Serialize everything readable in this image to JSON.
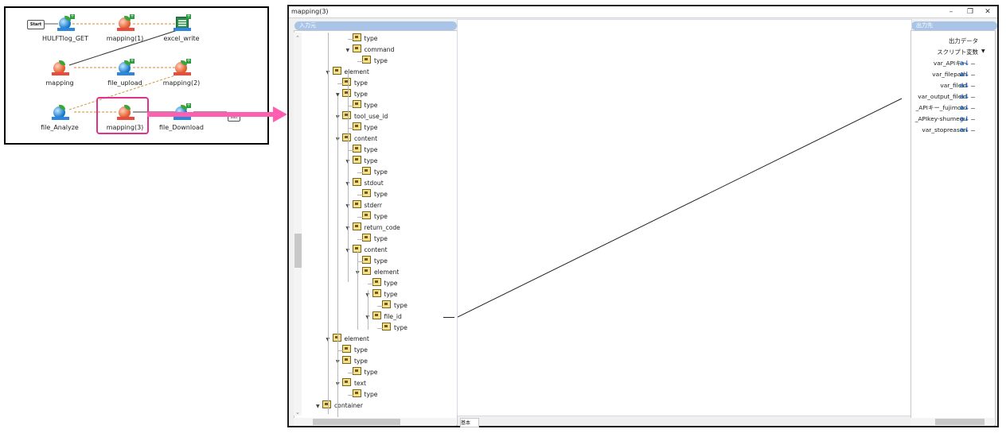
{
  "flow": {
    "start_label": "Start",
    "end_label": "End",
    "nodes": {
      "hulftlog_get": "HULFTlog_GET",
      "mapping1": "mapping(1)",
      "excel_write": "excel_write",
      "mapping": "mapping",
      "file_upload": "file_upload",
      "mapping2": "mapping(2)",
      "file_analyze": "file_Analyze",
      "mapping3": "mapping(3)",
      "file_download": "file_Download"
    }
  },
  "window": {
    "title": "mapping(3)",
    "minimize": "–",
    "restore": "❐",
    "close": "✕",
    "input_header": "入力元",
    "output_header": "出力先",
    "bottom_tab": "基本"
  },
  "input_tree": [
    {
      "label": "type",
      "level": 3,
      "expand": false
    },
    {
      "label": "command",
      "level": 3,
      "expand": true
    },
    {
      "label": "type",
      "level": 4,
      "expand": false
    },
    {
      "label": "element",
      "level": 1,
      "expand": true
    },
    {
      "label": "type",
      "level": 2,
      "expand": false
    },
    {
      "label": "type",
      "level": 2,
      "expand": true
    },
    {
      "label": "type",
      "level": 3,
      "expand": false
    },
    {
      "label": "tool_use_id",
      "level": 2,
      "expand": true
    },
    {
      "label": "type",
      "level": 3,
      "expand": false
    },
    {
      "label": "content",
      "level": 2,
      "expand": true
    },
    {
      "label": "type",
      "level": 3,
      "expand": false
    },
    {
      "label": "type",
      "level": 3,
      "expand": true
    },
    {
      "label": "type",
      "level": 4,
      "expand": false
    },
    {
      "label": "stdout",
      "level": 3,
      "expand": true
    },
    {
      "label": "type",
      "level": 4,
      "expand": false
    },
    {
      "label": "stderr",
      "level": 3,
      "expand": true
    },
    {
      "label": "type",
      "level": 4,
      "expand": false
    },
    {
      "label": "return_code",
      "level": 3,
      "expand": true
    },
    {
      "label": "type",
      "level": 4,
      "expand": false
    },
    {
      "label": "content",
      "level": 3,
      "expand": true
    },
    {
      "label": "type",
      "level": 4,
      "expand": false
    },
    {
      "label": "element",
      "level": 4,
      "expand": true
    },
    {
      "label": "type",
      "level": 5,
      "expand": false
    },
    {
      "label": "type",
      "level": 5,
      "expand": true
    },
    {
      "label": "type",
      "level": 6,
      "expand": false
    },
    {
      "label": "file_id",
      "level": 5,
      "expand": true
    },
    {
      "label": "type",
      "level": 6,
      "expand": false
    },
    {
      "label": "element",
      "level": 1,
      "expand": true
    },
    {
      "label": "type",
      "level": 2,
      "expand": false
    },
    {
      "label": "type",
      "level": 2,
      "expand": true
    },
    {
      "label": "type",
      "level": 3,
      "expand": false
    },
    {
      "label": "text",
      "level": 2,
      "expand": true
    },
    {
      "label": "type",
      "level": 3,
      "expand": false
    },
    {
      "label": "container",
      "level": 0,
      "expand": true
    }
  ],
  "output_tree": [
    {
      "label": "出力データ",
      "icon": false
    },
    {
      "label": "スクリプト変数",
      "icon": false,
      "expand": true
    },
    {
      "label": "var_APIキー",
      "icon": true
    },
    {
      "label": "var_filepath",
      "icon": true
    },
    {
      "label": "var_fileid",
      "icon": true
    },
    {
      "label": "var_output_fileid",
      "icon": true
    },
    {
      "label": "_APIキー_fujimoto",
      "icon": true
    },
    {
      "label": "_APIkey-shumegu",
      "icon": true
    },
    {
      "label": "var_stopreason",
      "icon": true
    }
  ],
  "mapping_link": {
    "from": "file_id",
    "to": "var_output_fileid"
  },
  "colors": {
    "highlight": "#e0328a",
    "arrow": "#ff5fb0",
    "panel_header": "#a9c4e6"
  }
}
